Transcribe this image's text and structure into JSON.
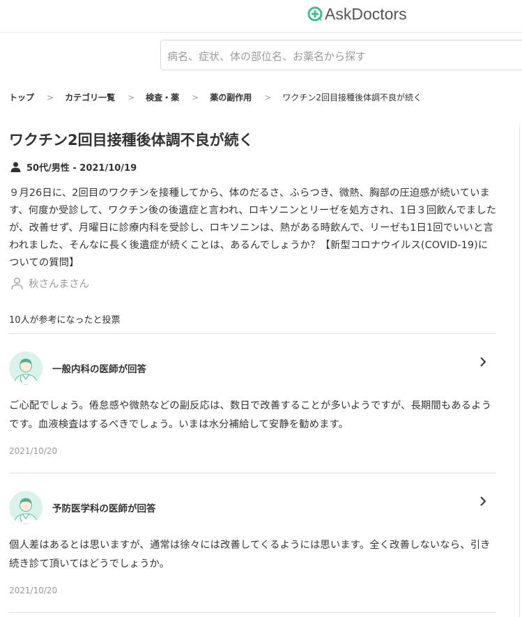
{
  "header": {
    "logo_text": "AskDoctors",
    "brand_color": "#3cc08a"
  },
  "search": {
    "placeholder": "病名、症状、体の部位名、お薬名から探す"
  },
  "breadcrumb": [
    "トップ",
    "カテゴリ一覧",
    "検査・薬",
    "薬の副作用",
    "ワクチン2回目接種後体調不良が続く"
  ],
  "breadcrumb_separator": ">",
  "question": {
    "title": "ワクチン2回目接種後体調不良が続く",
    "meta": "50代/男性 - 2021/10/19",
    "body": "９月26日に、2回目のワクチンを接種してから、体のだるさ、ふらつき、微熱、胸部の圧迫感が続いています、何度か受診して、ワクチン後の後遺症と言われ、ロキソニンとリーゼを処方され、1日３回飲んでましたが、改善せず、月曜日に診療内科を受診し、ロキソニンは、熱がある時飲んで、リーゼも1日1回でいいと言われました、そんなに長く後遺症が続くことは、あるんでしょうか？【新型コロナウイルス(COVID-19)についての質問】",
    "asker": "秋さんまさん",
    "votes": "10人が参考になったと投票"
  },
  "answers": [
    {
      "role": "一般内科の医師が回答",
      "text": "ご心配でしょう。倦怠感や微熱などの副反応は、数日で改善することが多いようですが、長期間もあるようです。血液検査はするべきでしょう。いまは水分補給して安静を勧めます。",
      "date": "2021/10/20"
    },
    {
      "role": "予防医学科の医師が回答",
      "text": "個人差はあるとは思いますが、通常は徐々には改善してくるようには思います。全く改善しないなら、引き続き診て頂いてはどうでしょうか。",
      "date": "2021/10/20"
    }
  ],
  "icons": {
    "logo": "plus-bubble-icon",
    "user": "user-icon",
    "asker": "user-outline-icon",
    "chevron": "chevron-right-icon",
    "avatar": "doctor-avatar-icon"
  }
}
